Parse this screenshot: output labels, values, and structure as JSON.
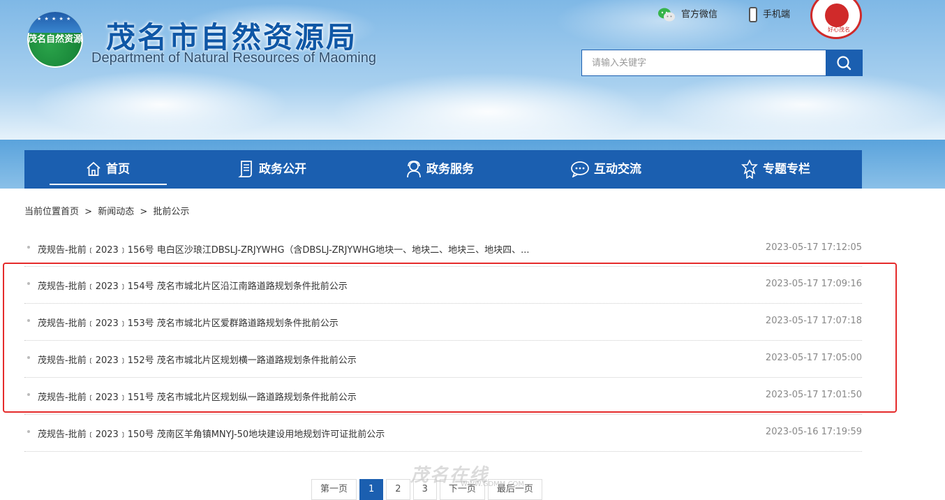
{
  "header": {
    "logo_text": "茂名自然资源",
    "title_cn": "茂名市自然资源局",
    "title_en": "Department of Natural Resources of Maoming",
    "wechat_label": "官方微信",
    "mobile_label": "手机端",
    "seal_text": "好心茂名",
    "search_placeholder": "请输入关键字"
  },
  "nav": {
    "items": [
      {
        "label": "首页",
        "icon": "home-icon"
      },
      {
        "label": "政务公开",
        "icon": "document-icon"
      },
      {
        "label": "政务服务",
        "icon": "service-person-icon"
      },
      {
        "label": "互动交流",
        "icon": "chat-bubble-icon"
      },
      {
        "label": "专题专栏",
        "icon": "badge-icon"
      }
    ]
  },
  "breadcrumb": {
    "prefix": "当前位置",
    "items": [
      "首页",
      "新闻动态",
      "批前公示"
    ],
    "sep": ">"
  },
  "articles": [
    {
      "title": "茂规告-批前﹝2023﹞156号 电白区沙琅江DBSLJ-ZRJYWHG（含DBSLJ-ZRJYWHG地块一、地块二、地块三、地块四、...",
      "date": "2023-05-17 17:12:05"
    },
    {
      "title": "茂规告-批前﹝2023﹞154号 茂名市城北片区沿江南路道路规划条件批前公示",
      "date": "2023-05-17 17:09:16"
    },
    {
      "title": "茂规告-批前﹝2023﹞153号 茂名市城北片区爱群路道路规划条件批前公示",
      "date": "2023-05-17 17:07:18"
    },
    {
      "title": "茂规告-批前﹝2023﹞152号 茂名市城北片区规划横一路道路规划条件批前公示",
      "date": "2023-05-17 17:05:00"
    },
    {
      "title": "茂规告-批前﹝2023﹞151号 茂名市城北片区规划纵一路道路规划条件批前公示",
      "date": "2023-05-17 17:01:50"
    },
    {
      "title": "茂规告-批前﹝2023﹞150号 茂南区羊角镇MNYJ-50地块建设用地规划许可证批前公示",
      "date": "2023-05-16 17:19:59"
    }
  ],
  "pager": {
    "first": "第一页",
    "pages": [
      "1",
      "2",
      "3"
    ],
    "next": "下一页",
    "last": "最后一页"
  },
  "watermark": {
    "main": "茂名在线",
    "sub": "WWW.GDMM.COM"
  },
  "colors": {
    "brand_blue": "#1b5fb0",
    "highlight_red": "#e52b2b"
  }
}
